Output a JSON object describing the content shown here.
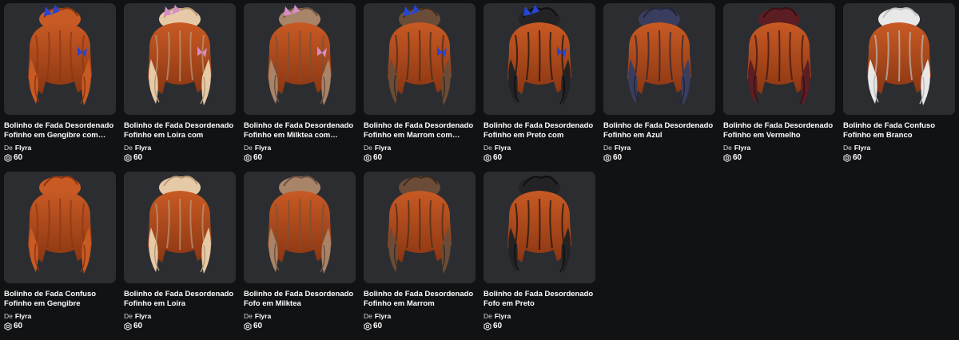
{
  "creator_prefix": "De",
  "items": [
    {
      "name": "Bolinho de Fada Desordenado Fofinho em Gengibre com…",
      "creator": "Flyra",
      "price": "60",
      "icon": "robux-icon",
      "hair_color": "#c85a24",
      "hair_dark": "#8a3612",
      "accent": "butterfly-blue",
      "accent_color": "#2645d6"
    },
    {
      "name": "Bolinho de Fada Desordenado Fofinho em Loira com Borboletas",
      "creator": "Flyra",
      "price": "60",
      "icon": "robux-icon",
      "hair_color": "#e6c9a6",
      "hair_dark": "#b99b78",
      "accent": "butterfly-pink",
      "accent_color": "#d88cc8"
    },
    {
      "name": "Bolinho de Fada Desordenado Fofinho em Milktea com…",
      "creator": "Flyra",
      "price": "60",
      "icon": "robux-icon",
      "hair_color": "#a88468",
      "hair_dark": "#6f5240",
      "accent": "butterfly-pink",
      "accent_color": "#d88cc8"
    },
    {
      "name": "Bolinho de Fada Desordenado Fofinho em Marrom com…",
      "creator": "Flyra",
      "price": "60",
      "icon": "robux-icon",
      "hair_color": "#6a4c38",
      "hair_dark": "#3e2b1f",
      "accent": "butterfly-blue",
      "accent_color": "#2645d6"
    },
    {
      "name": "Bolinho de Fada Desordenado Fofinho em Preto com Borboletas",
      "creator": "Flyra",
      "price": "60",
      "icon": "robux-icon",
      "hair_color": "#232325",
      "hair_dark": "#0f0f10",
      "accent": "butterfly-blue",
      "accent_color": "#2645d6"
    },
    {
      "name": "Bolinho de Fada Desordenado Fofinho em Azul",
      "creator": "Flyra",
      "price": "60",
      "icon": "robux-icon",
      "hair_color": "#3a3e5e",
      "hair_dark": "#22253a",
      "accent": "none",
      "accent_color": ""
    },
    {
      "name": "Bolinho de Fada Desordenado Fofinho em Vermelho",
      "creator": "Flyra",
      "price": "60",
      "icon": "robux-icon",
      "hair_color": "#5c1e22",
      "hair_dark": "#361013",
      "accent": "none",
      "accent_color": ""
    },
    {
      "name": "Bolinho de Fada Confuso Fofinho em Branco",
      "creator": "Flyra",
      "price": "60",
      "icon": "robux-icon",
      "hair_color": "#e8e8e8",
      "hair_dark": "#bdbdbd",
      "accent": "none",
      "accent_color": ""
    },
    {
      "name": "Bolinho de Fada Confuso Fofinho em Gengibre",
      "creator": "Flyra",
      "price": "60",
      "icon": "robux-icon",
      "hair_color": "#c85a24",
      "hair_dark": "#8a3612",
      "accent": "none",
      "accent_color": ""
    },
    {
      "name": "Bolinho de Fada Desordenado Fofinho em Loira",
      "creator": "Flyra",
      "price": "60",
      "icon": "robux-icon",
      "hair_color": "#e6c9a6",
      "hair_dark": "#b99b78",
      "accent": "none",
      "accent_color": ""
    },
    {
      "name": "Bolinho de Fada Desordenado Fofo em Milktea",
      "creator": "Flyra",
      "price": "60",
      "icon": "robux-icon",
      "hair_color": "#a88468",
      "hair_dark": "#6f5240",
      "accent": "none",
      "accent_color": ""
    },
    {
      "name": "Bolinho de Fada Desordenado Fofinho em Marrom",
      "creator": "Flyra",
      "price": "60",
      "icon": "robux-icon",
      "hair_color": "#6a4c38",
      "hair_dark": "#3e2b1f",
      "accent": "none",
      "accent_color": ""
    },
    {
      "name": "Bolinho de Fada Desordenado Fofo em Preto",
      "creator": "Flyra",
      "price": "60",
      "icon": "robux-icon",
      "hair_color": "#232325",
      "hair_dark": "#0f0f10",
      "accent": "none",
      "accent_color": ""
    }
  ]
}
